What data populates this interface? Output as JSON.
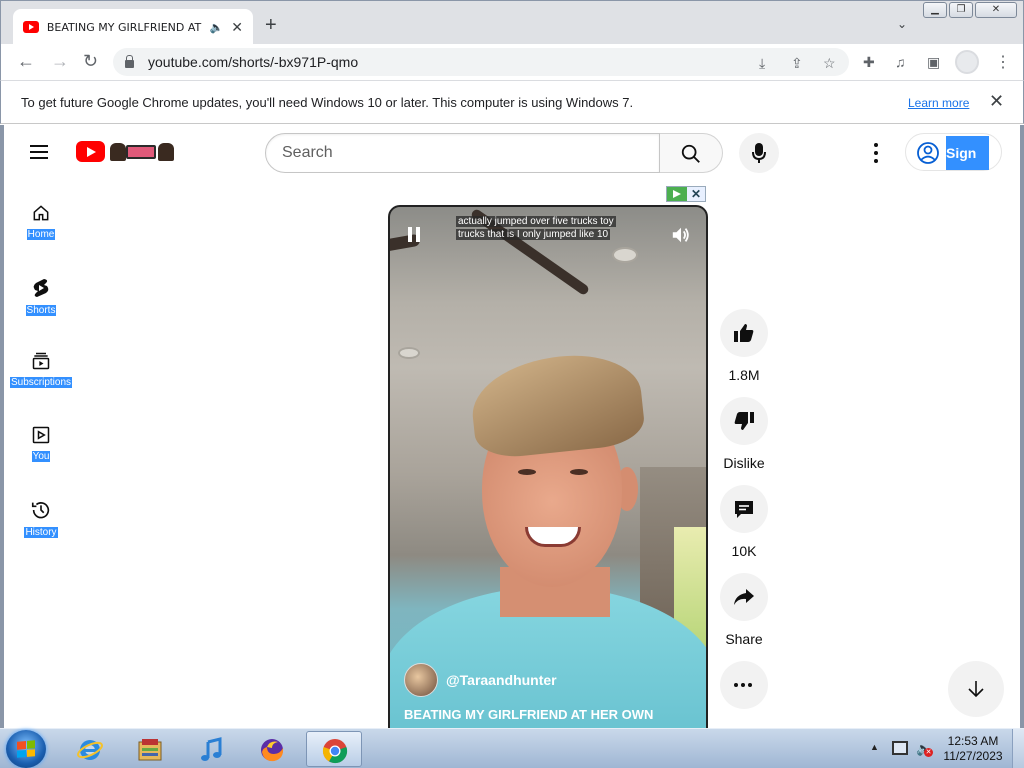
{
  "browser": {
    "tab": {
      "title": "BEATING MY GIRLFRIEND AT",
      "audio_icon": "speaker-icon",
      "close": "✕"
    },
    "new_tab": "+",
    "url": "youtube.com/shorts/-bx971P-qmo",
    "infobar": {
      "message": "To get future Google Chrome updates, you'll need Windows 10 or later. This computer is using Windows 7.",
      "learn_more": "Learn more"
    }
  },
  "youtube": {
    "search": {
      "placeholder": "Search"
    },
    "sign_in": "Sign in",
    "sidebar": [
      {
        "label": "Home",
        "icon": "home-icon"
      },
      {
        "label": "Shorts",
        "icon": "shorts-icon"
      },
      {
        "label": "Subscriptions",
        "icon": "subscriptions-icon"
      },
      {
        "label": "You",
        "icon": "you-icon"
      },
      {
        "label": "History",
        "icon": "history-icon"
      }
    ],
    "short": {
      "caption_line1": "actually jumped over five trucks toy",
      "caption_line2": "trucks that is I only jumped like 10",
      "channel": "@Taraandhunter",
      "title": "BEATING MY GIRLFRIEND AT HER OWN"
    },
    "actions": {
      "like_count": "1.8M",
      "dislike_label": "Dislike",
      "comment_count": "10K",
      "share_label": "Share"
    }
  },
  "taskbar": {
    "time": "12:53 AM",
    "date": "11/27/2023"
  },
  "colors": {
    "youtube_red": "#ff0000",
    "selection_blue": "#3390ff",
    "link_blue": "#1a73e8"
  }
}
